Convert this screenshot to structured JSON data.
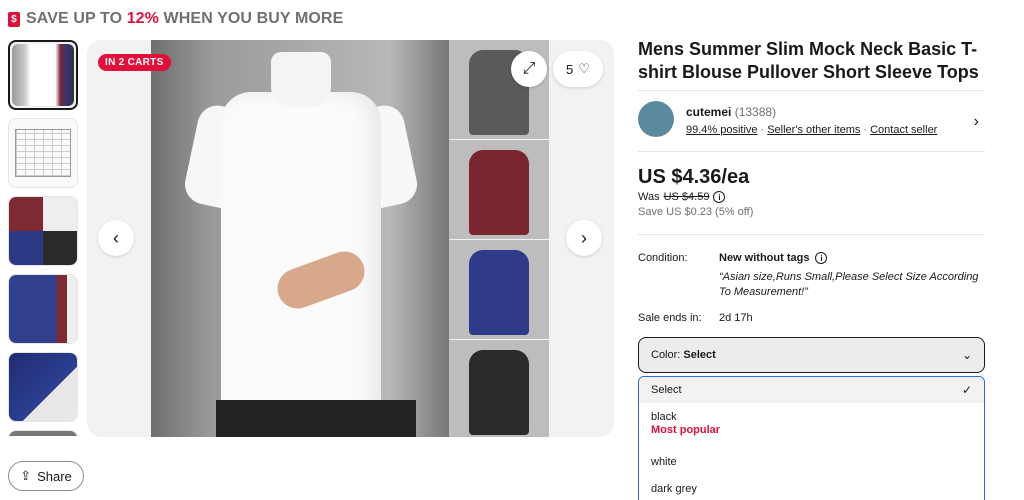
{
  "promo": {
    "prefix": "SAVE UP TO ",
    "percent": "12%",
    "suffix": " WHEN YOU BUY MORE"
  },
  "gallery": {
    "badge": "IN 2 CARTS",
    "watch_count": "5"
  },
  "share": {
    "label": "Share"
  },
  "listing": {
    "title": "Mens Summer Slim Mock Neck Basic T-shirt Blouse Pullover Short Sleeve Tops",
    "price": "US $4.36/ea",
    "was_label": "Was",
    "was_price": "US $4.59",
    "save": "Save US $0.23 (5% off)"
  },
  "seller": {
    "name": "cutemei",
    "count": "(13388)",
    "positive": "99.4% positive",
    "other_items": "Seller's other items",
    "contact": "Contact seller"
  },
  "details": {
    "condition_label": "Condition:",
    "condition_value": "New without tags",
    "condition_note": "“Asian size,Runs Small,Please Select Size According To Measurement!”",
    "sale_label": "Sale ends in:",
    "sale_value": "2d 17h"
  },
  "color_select": {
    "label": "Color:",
    "value": "Select",
    "options": [
      {
        "label": "Select"
      },
      {
        "label": "black",
        "note": "Most popular"
      },
      {
        "label": "white"
      },
      {
        "label": "dark grey"
      }
    ]
  },
  "colors": {
    "accent": "#e0103a",
    "focus": "#3665f3"
  }
}
